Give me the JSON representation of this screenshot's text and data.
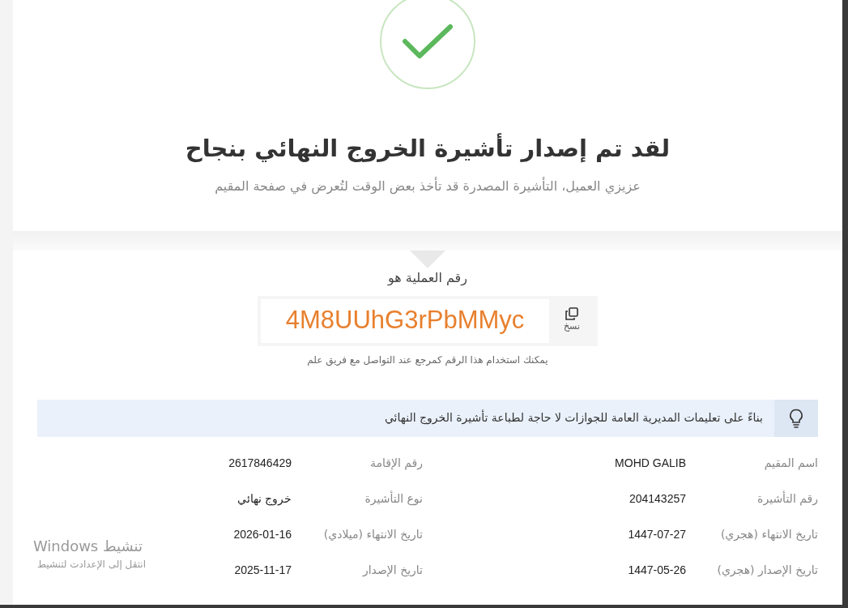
{
  "success": {
    "title": "لقد تم إصدار تأشيرة الخروج النهائي بنجاح",
    "subtitle": "عزيزي العميل، التأشيرة المصدرة قد تأخذ بعض الوقت لتُعرض في صفحة المقيم"
  },
  "transaction": {
    "label": "رقم العملية هو",
    "number": "4M8UUhG3rPbMMyc",
    "copy_label": "نسخ",
    "hint": "يمكنك استخدام هذا الرقم كمرجع عند التواصل مع فريق علم"
  },
  "notice": "بناءً على تعليمات المديرية العامة للجوازات لا حاجة لطباعة تأشيرة الخروج النهائي",
  "details": [
    {
      "label": "اسم المقيم",
      "value": "MOHD GALIB"
    },
    {
      "label": "رقم الإقامة",
      "value": "2617846429"
    },
    {
      "label": "رقم التأشيرة",
      "value": "204143257"
    },
    {
      "label": "نوع التأشيرة",
      "value": "خروج نهائي"
    },
    {
      "label": "تاريخ الانتهاء (هجري)",
      "value": "1447-07-27"
    },
    {
      "label": "تاريخ الانتهاء (ميلادي)",
      "value": "2026-01-16"
    },
    {
      "label": "تاريخ الإصدار (هجري)",
      "value": "1447-05-26"
    },
    {
      "label": "تاريخ الإصدار",
      "value": "2025-11-17"
    }
  ],
  "activation": {
    "title": "تنشيط Windows",
    "hint": "انتقل إلى الإعدادت لتنشيط"
  }
}
